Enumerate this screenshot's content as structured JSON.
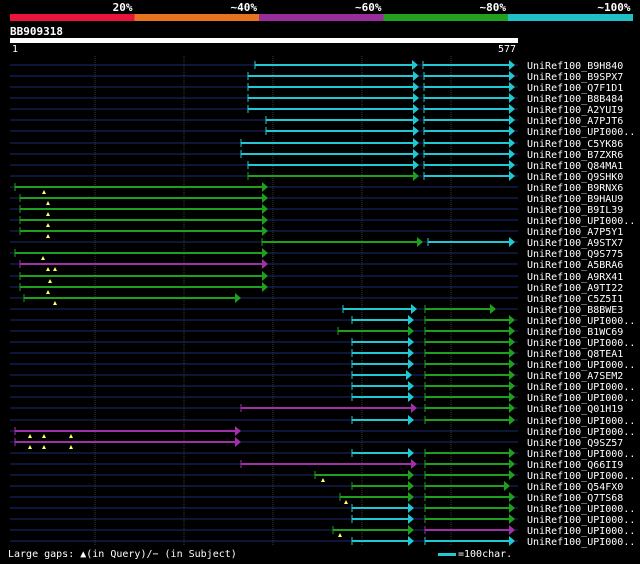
{
  "query": {
    "id": "BB909318",
    "start": "1",
    "end": "577",
    "length": 577
  },
  "identity_scale": [
    {
      "label": "20%",
      "color": "#e8143c"
    },
    {
      "label": "~40%",
      "color": "#e8731e"
    },
    {
      "label": "~60%",
      "color": "#9a2d9c"
    },
    {
      "label": "~80%",
      "color": "#22a01e"
    },
    {
      "label": "~100%",
      "color": "#20c0c8"
    }
  ],
  "legend": {
    "gaps_text": "Large gaps: ▲(in Query)/− (in Subject)",
    "scale_text": "=100char."
  },
  "hits": [
    {
      "name": "UniRef100_B9H840",
      "segs": [
        [
          255,
          418,
          "cyan"
        ],
        [
          423,
          515,
          "cyan"
        ]
      ]
    },
    {
      "name": "UniRef100_B9SPX7",
      "segs": [
        [
          248,
          419,
          "cyan"
        ],
        [
          424,
          515,
          "cyan"
        ]
      ]
    },
    {
      "name": "UniRef100_Q7F1D1",
      "segs": [
        [
          248,
          419,
          "cyan"
        ],
        [
          424,
          515,
          "cyan"
        ]
      ]
    },
    {
      "name": "UniRef100_B8B484",
      "segs": [
        [
          248,
          419,
          "cyan"
        ],
        [
          424,
          515,
          "cyan"
        ]
      ]
    },
    {
      "name": "UniRef100_A2YUI9",
      "segs": [
        [
          248,
          419,
          "cyan"
        ],
        [
          424,
          515,
          "cyan"
        ]
      ]
    },
    {
      "name": "UniRef100_A7PJT6",
      "segs": [
        [
          266,
          419,
          "cyan"
        ],
        [
          424,
          515,
          "cyan"
        ]
      ]
    },
    {
      "name": "UniRef100_UPI000..",
      "segs": [
        [
          266,
          419,
          "cyan"
        ],
        [
          424,
          515,
          "cyan"
        ]
      ]
    },
    {
      "name": "UniRef100_C5YK86",
      "segs": [
        [
          241,
          419,
          "cyan"
        ],
        [
          424,
          515,
          "cyan"
        ]
      ]
    },
    {
      "name": "UniRef100_B7ZXR6",
      "segs": [
        [
          241,
          419,
          "cyan"
        ],
        [
          424,
          515,
          "cyan"
        ]
      ]
    },
    {
      "name": "UniRef100_Q84MA1",
      "segs": [
        [
          248,
          419,
          "cyan"
        ],
        [
          424,
          515,
          "cyan"
        ]
      ]
    },
    {
      "name": "UniRef100_Q9SHK0",
      "segs": [
        [
          248,
          419,
          "green"
        ],
        [
          424,
          515,
          "cyan"
        ]
      ]
    },
    {
      "name": "UniRef100_B9RNX6",
      "segs": [
        [
          15,
          268,
          "green"
        ]
      ],
      "gaps": [
        44
      ]
    },
    {
      "name": "UniRef100_B9HAU9",
      "segs": [
        [
          20,
          268,
          "green"
        ]
      ],
      "gaps": [
        48
      ]
    },
    {
      "name": "UniRef100_B9IL39",
      "segs": [
        [
          20,
          268,
          "green"
        ]
      ],
      "gaps": [
        48
      ]
    },
    {
      "name": "UniRef100_UPI000..",
      "segs": [
        [
          20,
          268,
          "green"
        ]
      ],
      "gaps": [
        48
      ]
    },
    {
      "name": "UniRef100_A7P5Y1",
      "segs": [
        [
          20,
          268,
          "green"
        ]
      ],
      "gaps": [
        48
      ]
    },
    {
      "name": "UniRef100_A9STX7",
      "segs": [
        [
          262,
          423,
          "green"
        ],
        [
          428,
          515,
          "cyan"
        ]
      ]
    },
    {
      "name": "UniRef100_Q9S775",
      "segs": [
        [
          15,
          268,
          "green"
        ]
      ],
      "gaps": [
        43
      ]
    },
    {
      "name": "UniRef100_A5BRA6",
      "segs": [
        [
          20,
          268,
          "purple"
        ]
      ],
      "gaps": [
        48,
        55
      ]
    },
    {
      "name": "UniRef100_A9RX41",
      "segs": [
        [
          20,
          268,
          "green"
        ]
      ],
      "gaps": [
        50
      ]
    },
    {
      "name": "UniRef100_A9TI22",
      "segs": [
        [
          20,
          268,
          "green"
        ]
      ],
      "gaps": [
        48
      ]
    },
    {
      "name": "UniRef100_C5Z5I1",
      "segs": [
        [
          24,
          241,
          "green"
        ]
      ],
      "gaps": [
        55
      ]
    },
    {
      "name": "UniRef100_B8BWE3",
      "segs": [
        [
          343,
          417,
          "cyan"
        ],
        [
          425,
          496,
          "green"
        ]
      ]
    },
    {
      "name": "UniRef100_UPI000..",
      "segs": [
        [
          352,
          414,
          "cyan"
        ],
        [
          425,
          515,
          "green"
        ]
      ]
    },
    {
      "name": "UniRef100_B1WC69",
      "segs": [
        [
          338,
          414,
          "green"
        ],
        [
          425,
          515,
          "green"
        ]
      ]
    },
    {
      "name": "UniRef100_UPI000..",
      "segs": [
        [
          352,
          414,
          "cyan"
        ],
        [
          425,
          515,
          "green"
        ]
      ]
    },
    {
      "name": "UniRef100_Q8TEA1",
      "segs": [
        [
          352,
          414,
          "cyan"
        ],
        [
          425,
          515,
          "green"
        ]
      ]
    },
    {
      "name": "UniRef100_UPI000..",
      "segs": [
        [
          352,
          414,
          "cyan"
        ],
        [
          425,
          515,
          "green"
        ]
      ]
    },
    {
      "name": "UniRef100_A7SEM2",
      "segs": [
        [
          352,
          412,
          "cyan"
        ],
        [
          425,
          515,
          "green"
        ]
      ]
    },
    {
      "name": "UniRef100_UPI000..",
      "segs": [
        [
          352,
          414,
          "cyan"
        ],
        [
          425,
          515,
          "green"
        ]
      ]
    },
    {
      "name": "UniRef100_UPI000..",
      "segs": [
        [
          352,
          414,
          "cyan"
        ],
        [
          425,
          515,
          "green"
        ]
      ]
    },
    {
      "name": "UniRef100_Q01H19",
      "segs": [
        [
          241,
          417,
          "purple"
        ],
        [
          425,
          515,
          "green"
        ]
      ]
    },
    {
      "name": "UniRef100_UPI000..",
      "segs": [
        [
          352,
          414,
          "cyan"
        ],
        [
          425,
          515,
          "green"
        ]
      ]
    },
    {
      "name": "UniRef100_UPI000..",
      "segs": [
        [
          15,
          241,
          "purple"
        ]
      ],
      "gaps": [
        30,
        44,
        71
      ]
    },
    {
      "name": "UniRef100_Q9SZ57",
      "segs": [
        [
          15,
          241,
          "purple"
        ]
      ],
      "gaps": [
        30,
        44,
        71
      ]
    },
    {
      "name": "UniRef100_UPI000..",
      "segs": [
        [
          352,
          414,
          "cyan"
        ],
        [
          425,
          515,
          "green"
        ]
      ]
    },
    {
      "name": "UniRef100_Q66II9",
      "segs": [
        [
          241,
          417,
          "purple"
        ],
        [
          425,
          515,
          "green"
        ]
      ]
    },
    {
      "name": "UniRef100_UPI000..",
      "segs": [
        [
          315,
          414,
          "green"
        ],
        [
          425,
          515,
          "green"
        ]
      ],
      "gaps": [
        323
      ]
    },
    {
      "name": "UniRef100_Q54FX0",
      "segs": [
        [
          352,
          414,
          "green"
        ],
        [
          425,
          510,
          "green"
        ]
      ]
    },
    {
      "name": "UniRef100_Q7TS68",
      "segs": [
        [
          340,
          414,
          "green"
        ],
        [
          425,
          515,
          "green"
        ]
      ],
      "gaps": [
        346
      ]
    },
    {
      "name": "UniRef100_UPI000..",
      "segs": [
        [
          352,
          414,
          "cyan"
        ],
        [
          425,
          515,
          "green"
        ]
      ]
    },
    {
      "name": "UniRef100_UPI000..",
      "segs": [
        [
          352,
          414,
          "cyan"
        ],
        [
          425,
          515,
          "green"
        ]
      ]
    },
    {
      "name": "UniRef100_UPI000..",
      "segs": [
        [
          333,
          414,
          "green"
        ],
        [
          425,
          515,
          "purple"
        ]
      ],
      "gaps": [
        340
      ]
    },
    {
      "name": "UniRef100_UPI000..",
      "segs": [
        [
          352,
          414,
          "cyan"
        ],
        [
          425,
          515,
          "cyan"
        ]
      ]
    }
  ]
}
